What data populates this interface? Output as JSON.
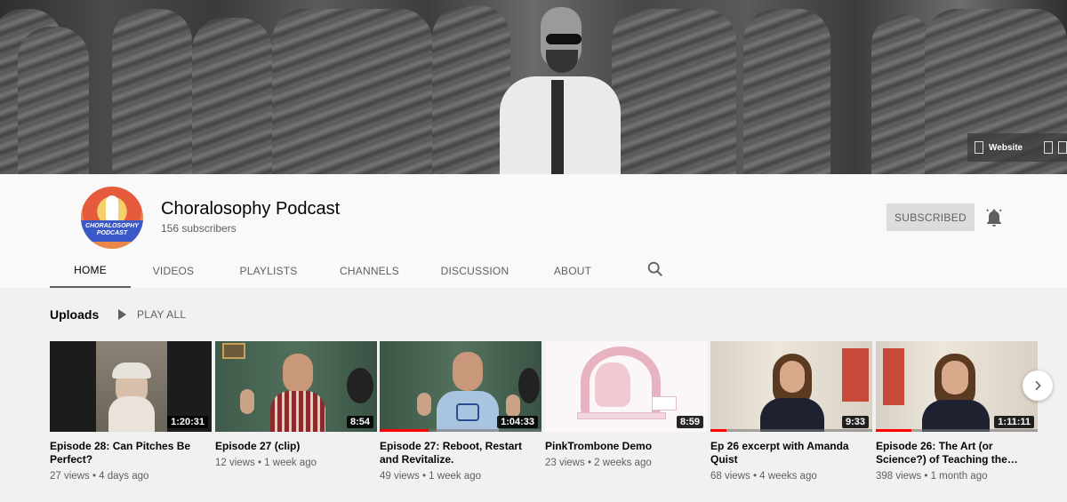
{
  "banner": {
    "link_label": "Website"
  },
  "channel": {
    "name": "Choralosophy Podcast",
    "subscribers": "156 subscribers",
    "avatar_text": "CHORALOSOPHY PODCAST",
    "subscribe_label": "SUBSCRIBED"
  },
  "tabs": [
    {
      "label": "HOME"
    },
    {
      "label": "VIDEOS"
    },
    {
      "label": "PLAYLISTS"
    },
    {
      "label": "CHANNELS"
    },
    {
      "label": "DISCUSSION"
    },
    {
      "label": "ABOUT"
    }
  ],
  "uploads": {
    "title": "Uploads",
    "play_all": "PLAY ALL",
    "videos": [
      {
        "title": "Episode 28: Can Pitches Be Perfect?",
        "duration": "1:20:31",
        "views": "27 views",
        "age": "4 days ago",
        "watched": 0
      },
      {
        "title": "Episode 27 (clip)",
        "duration": "8:54",
        "views": "12 views",
        "age": "1 week ago",
        "watched": 0
      },
      {
        "title": "Episode 27: Reboot, Restart and Revitalize.",
        "duration": "1:04:33",
        "views": "49 views",
        "age": "1 week ago",
        "watched": 0.3
      },
      {
        "title": "PinkTrombone Demo",
        "duration": "8:59",
        "views": "23 views",
        "age": "2 weeks ago",
        "watched": 0
      },
      {
        "title": "Ep 26 excerpt with Amanda Quist",
        "duration": "9:33",
        "views": "68 views",
        "age": "4 weeks ago",
        "watched": 0.1
      },
      {
        "title": "Episode 26: The Art (or Science?) of Teaching the…",
        "duration": "1:11:11",
        "views": "398 views",
        "age": "1 month ago",
        "watched": 0.22
      }
    ]
  },
  "icons": {
    "bell": "notification-bell-icon",
    "search": "search-icon",
    "play": "play-icon",
    "next": "chevron-right-icon"
  }
}
